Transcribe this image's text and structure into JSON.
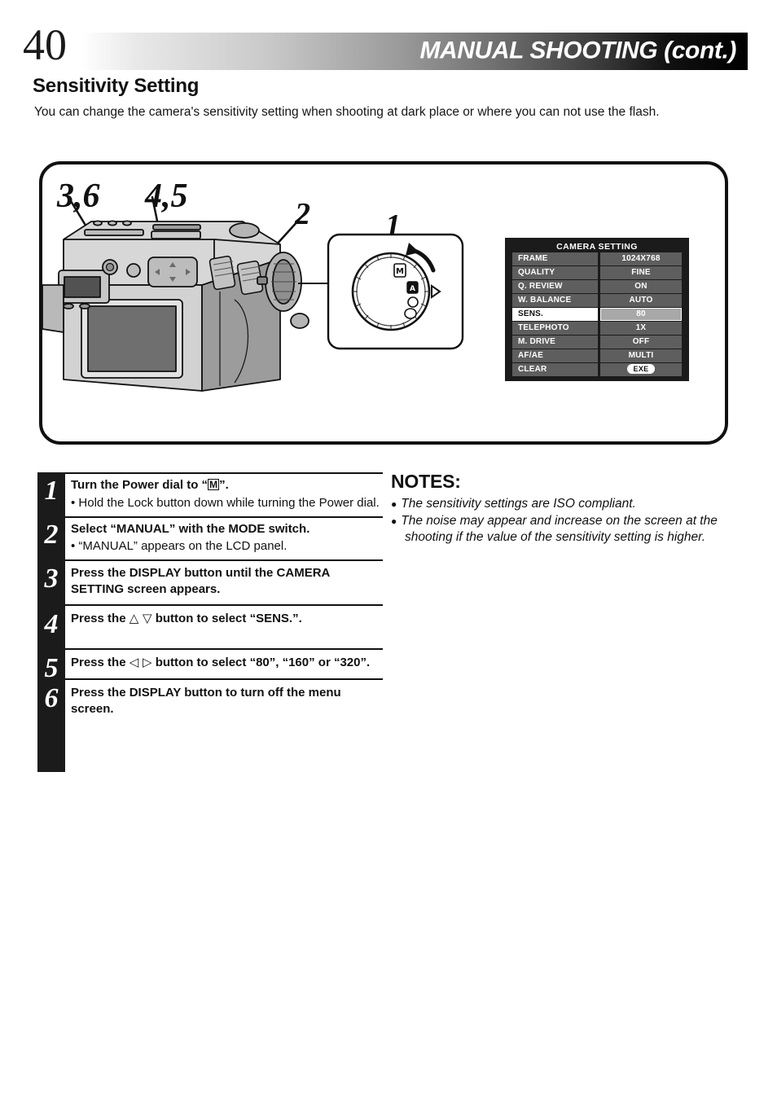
{
  "header": {
    "page_number": "40",
    "title": "MANUAL SHOOTING (cont.)"
  },
  "section": {
    "title": "Sensitivity Setting",
    "intro": "You can change the camera's sensitivity setting when shooting at dark place or where you can not use the flash."
  },
  "illustration": {
    "callouts": [
      {
        "name": "callout-3-6",
        "label": "3,6"
      },
      {
        "name": "callout-4-5",
        "label": "4,5"
      },
      {
        "name": "callout-2",
        "label": "2"
      },
      {
        "name": "callout-1",
        "label": "1"
      }
    ],
    "dial_modes": [
      "M",
      "A",
      "circle",
      "circle"
    ]
  },
  "camera_setting": {
    "title": "CAMERA SETTING",
    "rows": [
      {
        "label": "FRAME",
        "value": "1024X768",
        "selected": false
      },
      {
        "label": "QUALITY",
        "value": "FINE",
        "selected": false
      },
      {
        "label": "Q. REVIEW",
        "value": "ON",
        "selected": false
      },
      {
        "label": "W. BALANCE",
        "value": "AUTO",
        "selected": false
      },
      {
        "label": "SENS.",
        "value": "80",
        "selected": true
      },
      {
        "label": "TELEPHOTO",
        "value": "1X",
        "selected": false
      },
      {
        "label": "M. DRIVE",
        "value": "OFF",
        "selected": false
      },
      {
        "label": "AF/AE",
        "value": "MULTI",
        "selected": false
      },
      {
        "label": "CLEAR",
        "value": "EXE",
        "selected": false,
        "pill": true
      }
    ]
  },
  "steps": [
    {
      "number": "1",
      "title_pre": "Turn the Power dial to “",
      "title_box": "M",
      "title_post": "”.",
      "sub": "• Hold the Lock button down while turning the Power dial."
    },
    {
      "number": "2",
      "title": "Select “MANUAL” with the MODE switch.",
      "sub": "• “MANUAL” appears on the LCD panel."
    },
    {
      "number": "3",
      "title": "Press the DISPLAY button until the CAMERA SETTING screen appears."
    },
    {
      "number": "4",
      "title_pre": "Press the ",
      "title_glyph": "△ ▽",
      "title_post": " button to select “SENS.”."
    },
    {
      "number": "5",
      "title_pre": "Press the ",
      "title_glyph": "◁ ▷",
      "title_post": " button to select “80”, “160” or “320”."
    },
    {
      "number": "6",
      "title": "Press the DISPLAY button to turn off the menu screen."
    }
  ],
  "notes": {
    "heading": "NOTES:",
    "items": [
      "The sensitivity settings are ISO compliant.",
      "The noise may appear and increase on the screen at the shooting if the value of the sensitivity setting is higher."
    ]
  },
  "colors": {
    "ink": "#111111",
    "menu_bg": "#1b1b1b",
    "menu_row": "#5e5e5e",
    "menu_selected_value": "#a8a8a8"
  }
}
